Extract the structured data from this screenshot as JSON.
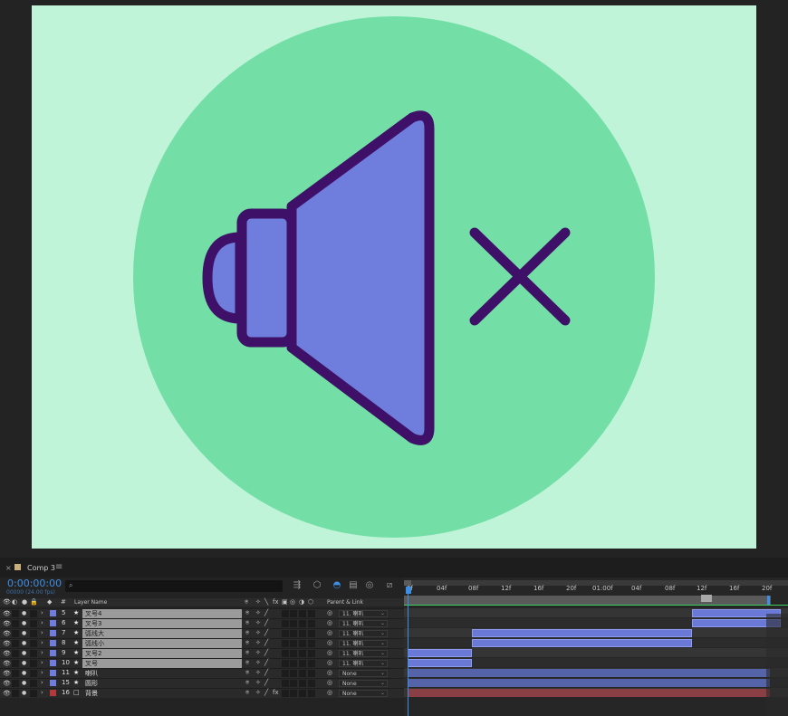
{
  "colors": {
    "canvas_bg": "#c0f4d9",
    "circle": "#73dfa7",
    "speaker_fill": "#6f7ddd",
    "stroke": "#3e1067",
    "accent": "#3d8fe6"
  },
  "composition": {
    "tab_label": "Comp 3",
    "tab_close": "×",
    "tab_menu": "≡"
  },
  "timeline": {
    "timecode": "0:00:00:00",
    "fps": "00000 (24.00 fps)",
    "search_icon": "⌕",
    "ruler": [
      "0f",
      "04f",
      "08f",
      "12f",
      "16f",
      "20f",
      "01:00f",
      "04f",
      "08f",
      "12f",
      "16f",
      "20f"
    ],
    "columns": {
      "hash": "#",
      "layer_name": "Layer Name",
      "parent_link": "Parent & Link"
    }
  },
  "layers": [
    {
      "num": "5",
      "type": "★",
      "name": "叉号4",
      "selected": true,
      "color": "#6f7ddd",
      "parent": "11. 喇叭"
    },
    {
      "num": "6",
      "type": "★",
      "name": "叉号3",
      "selected": true,
      "color": "#6f7ddd",
      "parent": "11. 喇叭"
    },
    {
      "num": "7",
      "type": "★",
      "name": "弧线大",
      "selected": true,
      "color": "#6f7ddd",
      "parent": "11. 喇叭"
    },
    {
      "num": "8",
      "type": "★",
      "name": "弧线小",
      "selected": true,
      "color": "#6f7ddd",
      "parent": "11. 喇叭"
    },
    {
      "num": "9",
      "type": "★",
      "name": "叉号2",
      "selected": true,
      "color": "#6f7ddd",
      "parent": "11. 喇叭"
    },
    {
      "num": "10",
      "type": "★",
      "name": "叉号",
      "selected": true,
      "color": "#6f7ddd",
      "parent": "11. 喇叭"
    },
    {
      "num": "11",
      "type": "★",
      "name": "喇叭",
      "selected": false,
      "color": "#6f7ddd",
      "parent": "None"
    },
    {
      "num": "15",
      "type": "★",
      "name": "圆形",
      "selected": false,
      "color": "#6f7ddd",
      "parent": "None"
    },
    {
      "num": "16",
      "type": "□",
      "name": "背景",
      "selected": false,
      "color": "#b5393b",
      "parent": "None"
    }
  ]
}
